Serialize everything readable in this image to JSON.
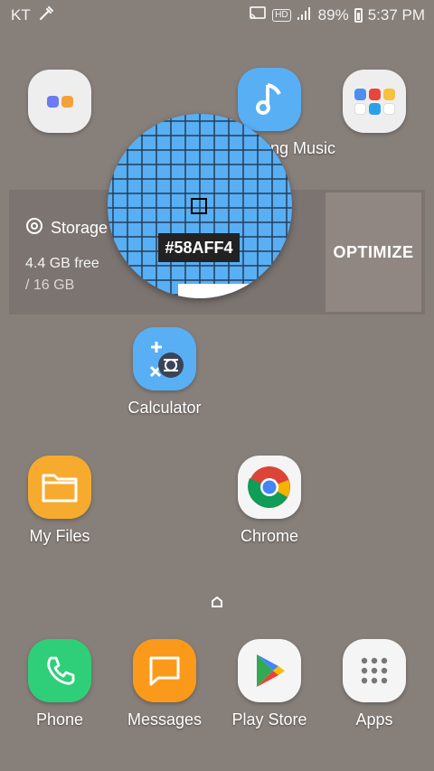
{
  "status_bar": {
    "carrier": "KT",
    "hd_badge": "HD",
    "battery": "89%",
    "time": "5:37 PM"
  },
  "home": {
    "music_app_label": "Samsung Music",
    "storage_widget": {
      "title": "Storage",
      "free": "4.4 GB free",
      "total": "/ 16 GB",
      "optimize_label": "OPTIMIZE"
    },
    "calculator_label": "Calculator",
    "myfiles_label": "My Files",
    "chrome_label": "Chrome"
  },
  "magnifier": {
    "color_hex": "#58AFF4"
  },
  "dock": {
    "phone_label": "Phone",
    "messages_label": "Messages",
    "playstore_label": "Play Store",
    "apps_label": "Apps"
  },
  "colors": {
    "wallpaper": "#877f7a",
    "music_blue": "#58aff4",
    "phone_green": "#2fcf7a",
    "messages_orange": "#fb9a1a",
    "myfiles_orange": "#f6ab2f"
  }
}
